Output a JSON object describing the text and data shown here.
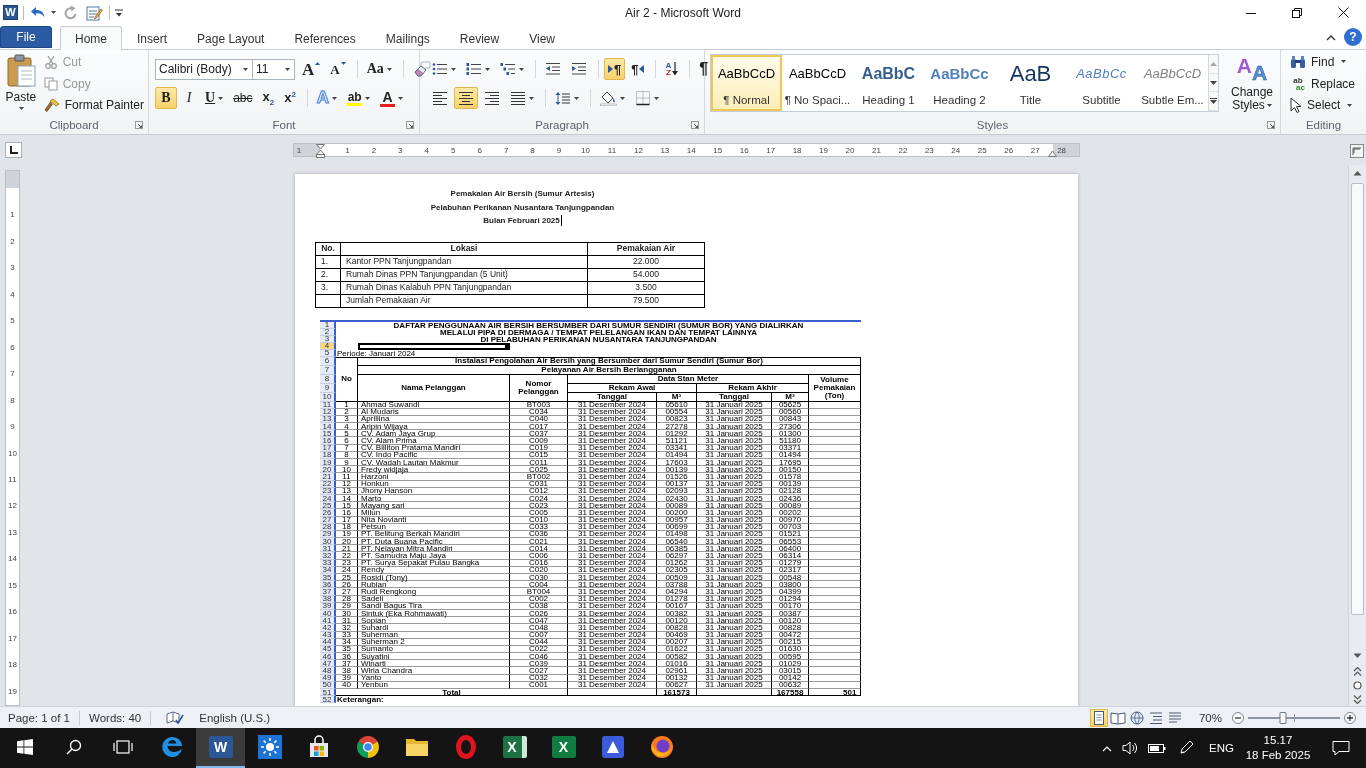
{
  "window": {
    "app_letter": "W",
    "title": "Air 2 - Microsoft Word",
    "help": "?"
  },
  "tabs": [
    {
      "label": "File",
      "kind": "backstage",
      "selected": false
    },
    {
      "label": "Home",
      "kind": "tab",
      "selected": true
    },
    {
      "label": "Insert",
      "kind": "tab",
      "selected": false
    },
    {
      "label": "Page Layout",
      "kind": "tab",
      "selected": false
    },
    {
      "label": "References",
      "kind": "tab",
      "selected": false
    },
    {
      "label": "Mailings",
      "kind": "tab",
      "selected": false
    },
    {
      "label": "Review",
      "kind": "tab",
      "selected": false
    },
    {
      "label": "View",
      "kind": "tab",
      "selected": false
    }
  ],
  "clipboard": {
    "label": "Clipboard",
    "paste": "Paste",
    "commands": [
      {
        "kind": "cut",
        "label": "Cut",
        "disabled": true
      },
      {
        "kind": "copy",
        "label": "Copy",
        "disabled": true
      },
      {
        "kind": "painter",
        "label": "Format Painter",
        "disabled": false
      }
    ]
  },
  "font": {
    "label": "Font",
    "font_name": "Calibri (Body)",
    "font_size": "11",
    "tools": [
      {
        "kind": "grow",
        "glyph": "A"
      },
      {
        "kind": "shrink",
        "glyph": "A"
      },
      {
        "kind": "case",
        "glyph": "Aa"
      },
      {
        "kind": "clear"
      }
    ],
    "formats": [
      {
        "kind": "bold",
        "glyph": "B",
        "selected": true
      },
      {
        "kind": "italic",
        "glyph": "I",
        "selected": false
      },
      {
        "kind": "underline",
        "glyph": "U",
        "selected": false
      },
      {
        "kind": "strike",
        "glyph": "abc",
        "selected": false
      },
      {
        "kind": "subscript",
        "glyph": "x$_{2}$",
        "selected": false
      },
      {
        "kind": "superscript",
        "glyph": "x$^{2}$",
        "selected": false
      },
      {
        "kind": "effects",
        "glyph": "A",
        "selected": false
      },
      {
        "kind": "highlight",
        "glyph": "ab",
        "selected": false
      },
      {
        "kind": "color",
        "glyph": "A",
        "selected": false
      }
    ]
  },
  "paragraph": {
    "label": "Paragraph",
    "tools": [
      {
        "kind": "bullets",
        "selected": false
      },
      {
        "kind": "numbering",
        "selected": false
      },
      {
        "kind": "multilevel",
        "selected": false
      },
      {
        "kind": "outdent",
        "selected": false
      },
      {
        "kind": "indent",
        "selected": false
      },
      {
        "kind": "ltr",
        "glyph": "¶",
        "selected": true
      },
      {
        "kind": "rtl",
        "glyph": "¶",
        "selected": false
      },
      {
        "kind": "sort",
        "glyphs": [
          "A",
          "Z"
        ],
        "selected": false
      },
      {
        "kind": "marks",
        "glyph": "¶",
        "selected": false
      }
    ],
    "aligns": [
      {
        "kind": "left",
        "selected": false
      },
      {
        "kind": "center",
        "selected": true
      },
      {
        "kind": "right",
        "selected": false
      },
      {
        "kind": "justify",
        "selected": false
      },
      {
        "kind": "spacing",
        "selected": false
      },
      {
        "kind": "shading",
        "selected": false
      },
      {
        "kind": "borders",
        "selected": false
      }
    ]
  },
  "styles": {
    "label": "Styles",
    "gallery": [
      {
        "kind": "normal",
        "preview": "AaBbCcD",
        "label": "¶ Normal",
        "selected": true
      },
      {
        "kind": "normal",
        "preview": "AaBbCcD",
        "label": "¶ No Spaci...",
        "selected": false
      },
      {
        "kind": "heading1",
        "preview": "AaBbC",
        "label": "Heading 1",
        "selected": false
      },
      {
        "kind": "heading2",
        "preview": "AaBbCc",
        "label": "Heading 2",
        "selected": false
      },
      {
        "kind": "title",
        "preview": "AaB",
        "label": "Title",
        "selected": false
      },
      {
        "kind": "subtitle",
        "preview": "AaBbCc",
        "label": "Subtitle",
        "selected": false
      },
      {
        "kind": "subtle",
        "preview": "AaBbCcD",
        "label": "Subtle Em...",
        "selected": false
      }
    ],
    "change_styles": {
      "label": "Change Styles",
      "glyphs": [
        "A",
        "A"
      ]
    }
  },
  "editing": {
    "label": "Editing",
    "commands": [
      {
        "kind": "find",
        "label": "Find"
      },
      {
        "kind": "replace",
        "label": "Replace",
        "glyphs": [
          "ab",
          "ac"
        ]
      },
      {
        "kind": "select",
        "label": "Select"
      }
    ]
  },
  "ruler": {
    "horizontal": [
      "1",
      "1",
      "2",
      "3",
      "4",
      "5",
      "6",
      "7",
      "8",
      "9",
      "10",
      "11",
      "12",
      "13",
      "14",
      "15",
      "16",
      "17",
      "18",
      "19",
      "20",
      "21",
      "22",
      "23",
      "24",
      "25",
      "26",
      "27",
      "28"
    ],
    "vertical": [
      "1",
      "2",
      "3",
      "4",
      "5",
      "6",
      "7",
      "8",
      "9",
      "10",
      "11",
      "12",
      "13",
      "14",
      "15",
      "16",
      "17",
      "18",
      "19"
    ]
  },
  "document": {
    "title_lines": [
      {
        "text": "Pemakaian Air Bersih (Sumur Artesis)",
        "caret": false
      },
      {
        "text": "Pelabuhan Perikanan Nusantara Tanjungpandan",
        "caret": false
      },
      {
        "text": "Bulan Februari 2025",
        "caret": true
      }
    ],
    "table": {
      "columns": [
        "No.",
        "Lokasi",
        "Pemakaian Air"
      ],
      "rows": [
        {
          "no": "1.",
          "location": "Kantor PPN Tanjungpandan",
          "usage": "22.000"
        },
        {
          "no": "2.",
          "location": "Rumah Dinas PPN Tanjungpandan (5 Unit)",
          "usage": "54.000"
        },
        {
          "no": "3.",
          "location": "Rumah Dinas Kalabuh PPN Tanjungpandan",
          "usage": "3.500"
        },
        {
          "location": "Jumlah Pemakaian Air",
          "usage": "79.500"
        }
      ]
    }
  },
  "spreadsheet": {
    "row_headers": [
      {
        "label": "1",
        "selected": false
      },
      {
        "label": "2",
        "selected": false
      },
      {
        "label": "3",
        "selected": false
      },
      {
        "label": "4",
        "selected": true
      },
      {
        "label": "5",
        "selected": false
      },
      {
        "label": "6",
        "selected": false
      },
      {
        "label": "7",
        "selected": false
      },
      {
        "label": "8",
        "selected": false
      },
      {
        "label": "9",
        "selected": false
      },
      {
        "label": "10",
        "selected": false
      },
      {
        "label": "11",
        "selected": false
      },
      {
        "label": "12",
        "selected": false
      },
      {
        "label": "13",
        "selected": false
      },
      {
        "label": "14",
        "selected": false
      },
      {
        "label": "15",
        "selected": false
      },
      {
        "label": "16",
        "selected": false
      },
      {
        "label": "17",
        "selected": false
      },
      {
        "label": "18",
        "selected": false
      },
      {
        "label": "19",
        "selected": false
      },
      {
        "label": "20",
        "selected": false
      },
      {
        "label": "21",
        "selected": false
      },
      {
        "label": "22",
        "selected": false
      },
      {
        "label": "23",
        "selected": false
      },
      {
        "label": "24",
        "selected": false
      },
      {
        "label": "25",
        "selected": false
      },
      {
        "label": "26",
        "selected": false
      },
      {
        "label": "27",
        "selected": false
      },
      {
        "label": "28",
        "selected": false
      },
      {
        "label": "29",
        "selected": false
      },
      {
        "label": "30",
        "selected": false
      },
      {
        "label": "31",
        "selected": false
      },
      {
        "label": "32",
        "selected": false
      },
      {
        "label": "33",
        "selected": false
      },
      {
        "label": "34",
        "selected": false
      },
      {
        "label": "35",
        "selected": false
      },
      {
        "label": "36",
        "selected": false
      },
      {
        "label": "37",
        "selected": false
      },
      {
        "label": "38",
        "selected": false
      },
      {
        "label": "39",
        "selected": false
      },
      {
        "label": "40",
        "selected": false
      },
      {
        "label": "41",
        "selected": false
      },
      {
        "label": "42",
        "selected": false
      },
      {
        "label": "43",
        "selected": false
      },
      {
        "label": "44",
        "selected": false
      },
      {
        "label": "45",
        "selected": false
      },
      {
        "label": "46",
        "selected": false
      },
      {
        "label": "47",
        "selected": false
      },
      {
        "label": "48",
        "selected": false
      },
      {
        "label": "49",
        "selected": false
      },
      {
        "label": "50",
        "selected": false
      },
      {
        "label": "51",
        "selected": false
      },
      {
        "label": "52",
        "selected": false
      }
    ],
    "title_lines": [
      "DAFTAR PENGGUNAAN AIR BERSIH BERSUMBER DARI SUMUR SENDIRI (SUMUR BOR) YANG DIALIRKAN",
      "MELALUI PIPA DI DERMAGA / TEMPAT PELELANGAN IKAN DAN TEMPAT LAINNYA",
      "DI PELABUHAN PERIKANAN NUSANTARA TANJUNGPANDAN"
    ],
    "period": "Periode: Januari 2024",
    "band_1": "Instalasi Pengolahan Air Bersih yang Bersumber dari Sumur Sendiri (Sumur Bor)",
    "band_2": "Pelayanan Air Bersih Berlangganan",
    "headers": {
      "no": "No",
      "name": "Nama Pelanggan",
      "number": "Nomor Pelanggan",
      "meter": "Data Stan Meter",
      "start": "Rekam Awal",
      "end": "Rekam Akhir",
      "start_date": "Tanggal",
      "start_m3": "M³",
      "end_date": "Tanggal",
      "end_m3": "M³",
      "volume": "Volume Pemakaian (Ton)"
    },
    "rows": [
      [
        "1",
        "Ahmad Suwandi",
        "BT003",
        "31 Desember 2024",
        "05610",
        "31 Januari 2025",
        "05625"
      ],
      [
        "2",
        "Al Mudaris",
        "C034",
        "31 Desember 2024",
        "00554",
        "31 Januari 2025",
        "00560"
      ],
      [
        "3",
        "Apriliina",
        "C040",
        "31 Desember 2024",
        "00823",
        "31 Januari 2025",
        "00843"
      ],
      [
        "4",
        "Aripin Wijaya",
        "C017",
        "31 Desember 2024",
        "27278",
        "31 Januari 2025",
        "27306"
      ],
      [
        "5",
        "CV. Adam Jaya Grup",
        "C037",
        "31 Desember 2024",
        "01292",
        "31 Januari 2025",
        "01300"
      ],
      [
        "6",
        "CV. Alam Prima",
        "C009",
        "31 Desember 2024",
        "51121",
        "31 Januari 2025",
        "51180"
      ],
      [
        "7",
        "CV. Billiton Pratama Mandiri",
        "C019",
        "31 Desember 2024",
        "03341",
        "31 Januari 2025",
        "03371"
      ],
      [
        "8",
        "CV. Indo Pacific",
        "C015",
        "31 Desember 2024",
        "01494",
        "31 Januari 2025",
        "01494"
      ],
      [
        "9",
        "CV. Wadah Lautan Makmur",
        "C011",
        "31 Desember 2024",
        "17603",
        "31 Januari 2025",
        "17695"
      ],
      [
        "10",
        "Fredy widjaja",
        "C025",
        "31 Desember 2024",
        "00139",
        "31 Januari 2025",
        "00150"
      ],
      [
        "11",
        "Harzoni",
        "BT002",
        "31 Desember 2024",
        "01526",
        "31 Januari 2025",
        "01578"
      ],
      [
        "12",
        "Honkun",
        "C031",
        "31 Desember 2024",
        "00137",
        "31 Januari 2025",
        "00139"
      ],
      [
        "13",
        "Jhony Hanson",
        "C012",
        "31 Desember 2024",
        "02093",
        "31 Januari 2025",
        "02128"
      ],
      [
        "14",
        "Marto",
        "C024",
        "31 Desember 2024",
        "02430",
        "31 Januari 2025",
        "02436"
      ],
      [
        "15",
        "Mayang sari",
        "C023",
        "31 Desember 2024",
        "00089",
        "31 Januari 2025",
        "00089"
      ],
      [
        "16",
        "Milun",
        "C005",
        "31 Desember 2024",
        "00200",
        "31 Januari 2025",
        "00202"
      ],
      [
        "17",
        "Nita Novianti",
        "C010",
        "31 Desember 2024",
        "00957",
        "31 Januari 2025",
        "00970"
      ],
      [
        "18",
        "Petsun",
        "C033",
        "31 Desember 2024",
        "00699",
        "31 Januari 2025",
        "00703"
      ],
      [
        "19",
        "PT. Belitung Berkah Mandiri",
        "C036",
        "31 Desember 2024",
        "01498",
        "31 Januari 2025",
        "01521"
      ],
      [
        "20",
        "PT. Duta Buana Pacific",
        "C021",
        "31 Desember 2024",
        "06540",
        "31 Januari 2025",
        "06553"
      ],
      [
        "21",
        "PT. Nelayan Mitra Mandiri",
        "C014",
        "31 Desember 2024",
        "06385",
        "31 Januari 2025",
        "06400"
      ],
      [
        "22",
        "PT. Samudra Maju Jaya",
        "C006",
        "31 Desember 2024",
        "06297",
        "31 Januari 2025",
        "06314"
      ],
      [
        "23",
        "PT. Surya Sepakat Pulau Bangka",
        "C016",
        "31 Desember 2024",
        "01262",
        "31 Januari 2025",
        "01279"
      ],
      [
        "24",
        "Rendy",
        "C020",
        "31 Desember 2024",
        "02305",
        "31 Januari 2025",
        "02317"
      ],
      [
        "25",
        "Rosidi (Tony)",
        "C030",
        "31 Desember 2024",
        "00509",
        "31 Januari 2025",
        "00548"
      ],
      [
        "26",
        "Rubian",
        "C004",
        "31 Desember 2024",
        "03788",
        "31 Januari 2025",
        "03800"
      ],
      [
        "27",
        "Rudi Rengkong",
        "BT004",
        "31 Desember 2024",
        "04294",
        "31 Januari 2025",
        "04399"
      ],
      [
        "28",
        "Sadeli",
        "C002",
        "31 Desember 2024",
        "01278",
        "31 Januari 2025",
        "01294"
      ],
      [
        "29",
        "Sandi Bagus Tira",
        "C038",
        "31 Desember 2024",
        "00167",
        "31 Januari 2025",
        "00170"
      ],
      [
        "30",
        "Sintuk (Eka Rohmawati)",
        "C026",
        "31 Desember 2024",
        "00382",
        "31 Januari 2025",
        "00387"
      ],
      [
        "31",
        "Sopian",
        "C047",
        "31 Desember 2024",
        "00120",
        "31 Januari 2025",
        "00120"
      ],
      [
        "32",
        "Suhardi",
        "C048",
        "31 Desember 2024",
        "00828",
        "31 Januari 2025",
        "00828"
      ],
      [
        "33",
        "Suherman",
        "C007",
        "31 Desember 2024",
        "00469",
        "31 Januari 2025",
        "00472"
      ],
      [
        "34",
        "Suherman 2",
        "C044",
        "31 Desember 2024",
        "00207",
        "31 Januari 2025",
        "00215"
      ],
      [
        "35",
        "Sumanto",
        "C022",
        "31 Desember 2024",
        "01622",
        "31 Januari 2025",
        "01630"
      ],
      [
        "36",
        "Suyatini",
        "C046",
        "31 Desember 2024",
        "00582",
        "31 Januari 2025",
        "00595"
      ],
      [
        "37",
        "Winarti",
        "C039",
        "31 Desember 2024",
        "01016",
        "31 Januari 2025",
        "01029"
      ],
      [
        "38",
        "Wiria Chandra",
        "C027",
        "31 Desember 2024",
        "02961",
        "31 Januari 2025",
        "03015"
      ],
      [
        "39",
        "Yanto",
        "C032",
        "31 Desember 2024",
        "00132",
        "31 Januari 2025",
        "00142"
      ],
      [
        "40",
        "Yenbun",
        "C001",
        "31 Desember 2024",
        "00627",
        "31 Januari 2025",
        "00632"
      ]
    ],
    "total": {
      "label": "Total",
      "start_m3": "161573",
      "end_m3": "167558",
      "volume": "501"
    },
    "note": "Keterangan:"
  },
  "status_bar": {
    "page": "Page: 1 of 1",
    "words": "Words: 40",
    "language": "English (U.S.)",
    "views": [
      {
        "kind": "print",
        "selected": true
      },
      {
        "kind": "reading",
        "selected": false
      },
      {
        "kind": "web",
        "selected": false
      },
      {
        "kind": "outline",
        "selected": false
      },
      {
        "kind": "draft",
        "selected": false
      }
    ],
    "zoom": "70%",
    "zoom_slider": {
      "level": 0.38
    }
  },
  "taskbar": {
    "buttons": [
      {
        "kind": "start"
      },
      {
        "kind": "search"
      },
      {
        "kind": "task_view"
      }
    ],
    "apps": [
      {
        "kind": "swirl",
        "selected": false
      },
      {
        "kind": "letter_doc",
        "glyph": "W",
        "selected": true
      },
      {
        "kind": "sun_tile",
        "selected": false
      },
      {
        "kind": "bag",
        "selected": false
      },
      {
        "kind": "segmented",
        "selected": false
      },
      {
        "kind": "folder",
        "selected": false
      },
      {
        "kind": "ring",
        "selected": false
      },
      {
        "kind": "letter_sheet_doc",
        "glyph": "X",
        "selected": false
      },
      {
        "kind": "letter_sheet",
        "glyph": "X",
        "selected": false
      },
      {
        "kind": "triangle_tile",
        "selected": false
      },
      {
        "kind": "fox",
        "selected": false
      }
    ],
    "tray": {
      "language": "ENG",
      "time": "15.17",
      "date": "18 Feb 2025"
    }
  }
}
